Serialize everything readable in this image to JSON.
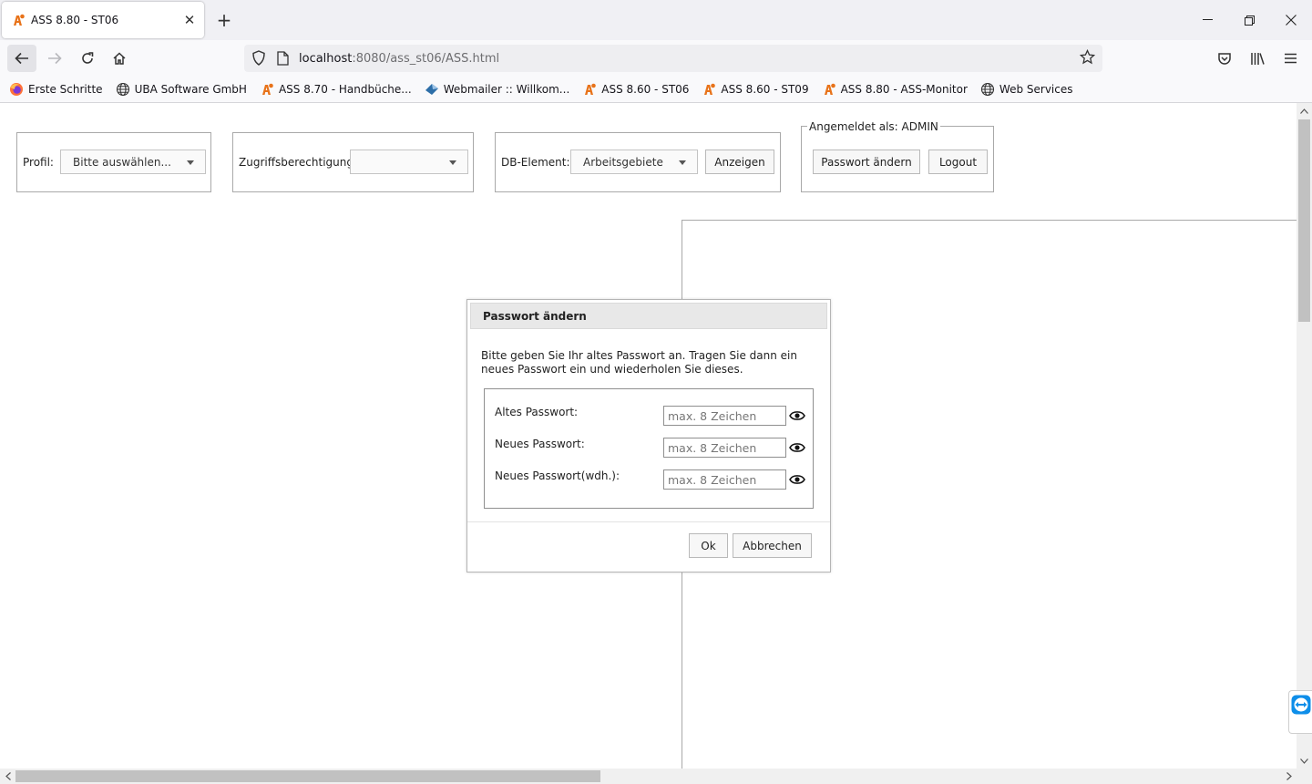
{
  "browser": {
    "tab_title": "ASS 8.80 - ST06",
    "url_host": "localhost",
    "url_path": ":8080/ass_st06/ASS.html",
    "bookmarks": [
      {
        "label": "Erste Schritte",
        "icon": "firefox-icon"
      },
      {
        "label": "UBA Software GmbH",
        "icon": "globe-icon"
      },
      {
        "label": "ASS 8.70 - Handbüche...",
        "icon": "ass-logo-icon"
      },
      {
        "label": "Webmailer :: Willkom...",
        "icon": "mail-icon"
      },
      {
        "label": "ASS 8.60 - ST06",
        "icon": "ass-logo-icon"
      },
      {
        "label": "ASS 8.60 - ST09",
        "icon": "ass-logo-icon"
      },
      {
        "label": "ASS 8.80 - ASS-Monitor",
        "icon": "ass-logo-icon"
      },
      {
        "label": "Web Services",
        "icon": "globe-icon"
      }
    ]
  },
  "toolbar": {
    "profil_label": "Profil:",
    "profil_value": "Bitte auswählen...",
    "zugriff_label": "Zugriffsberechtigung:",
    "zugriff_value": "",
    "dbelement_label": "DB-Element:",
    "dbelement_value": "Arbeitsgebiete",
    "anzeigen_label": "Anzeigen",
    "angemeldet_legend": "Angemeldet als: ADMIN",
    "passwort_aendern_label": "Passwort ändern",
    "logout_label": "Logout"
  },
  "dialog": {
    "title": "Passwort ändern",
    "description": "Bitte geben Sie Ihr altes Passwort an. Tragen Sie dann ein neues Passwort ein und wiederholen Sie dieses.",
    "fields": [
      {
        "label": "Altes Passwort:",
        "placeholder": "max. 8 Zeichen",
        "value": ""
      },
      {
        "label": "Neues Passwort:",
        "placeholder": "max. 8 Zeichen",
        "value": ""
      },
      {
        "label": "Neues Passwort(wdh.):",
        "placeholder": "max. 8 Zeichen",
        "value": ""
      }
    ],
    "ok_label": "Ok",
    "cancel_label": "Abbrechen"
  },
  "colors": {
    "ass_logo": "#e8731a",
    "teamviewer": "#0e8ee9"
  }
}
